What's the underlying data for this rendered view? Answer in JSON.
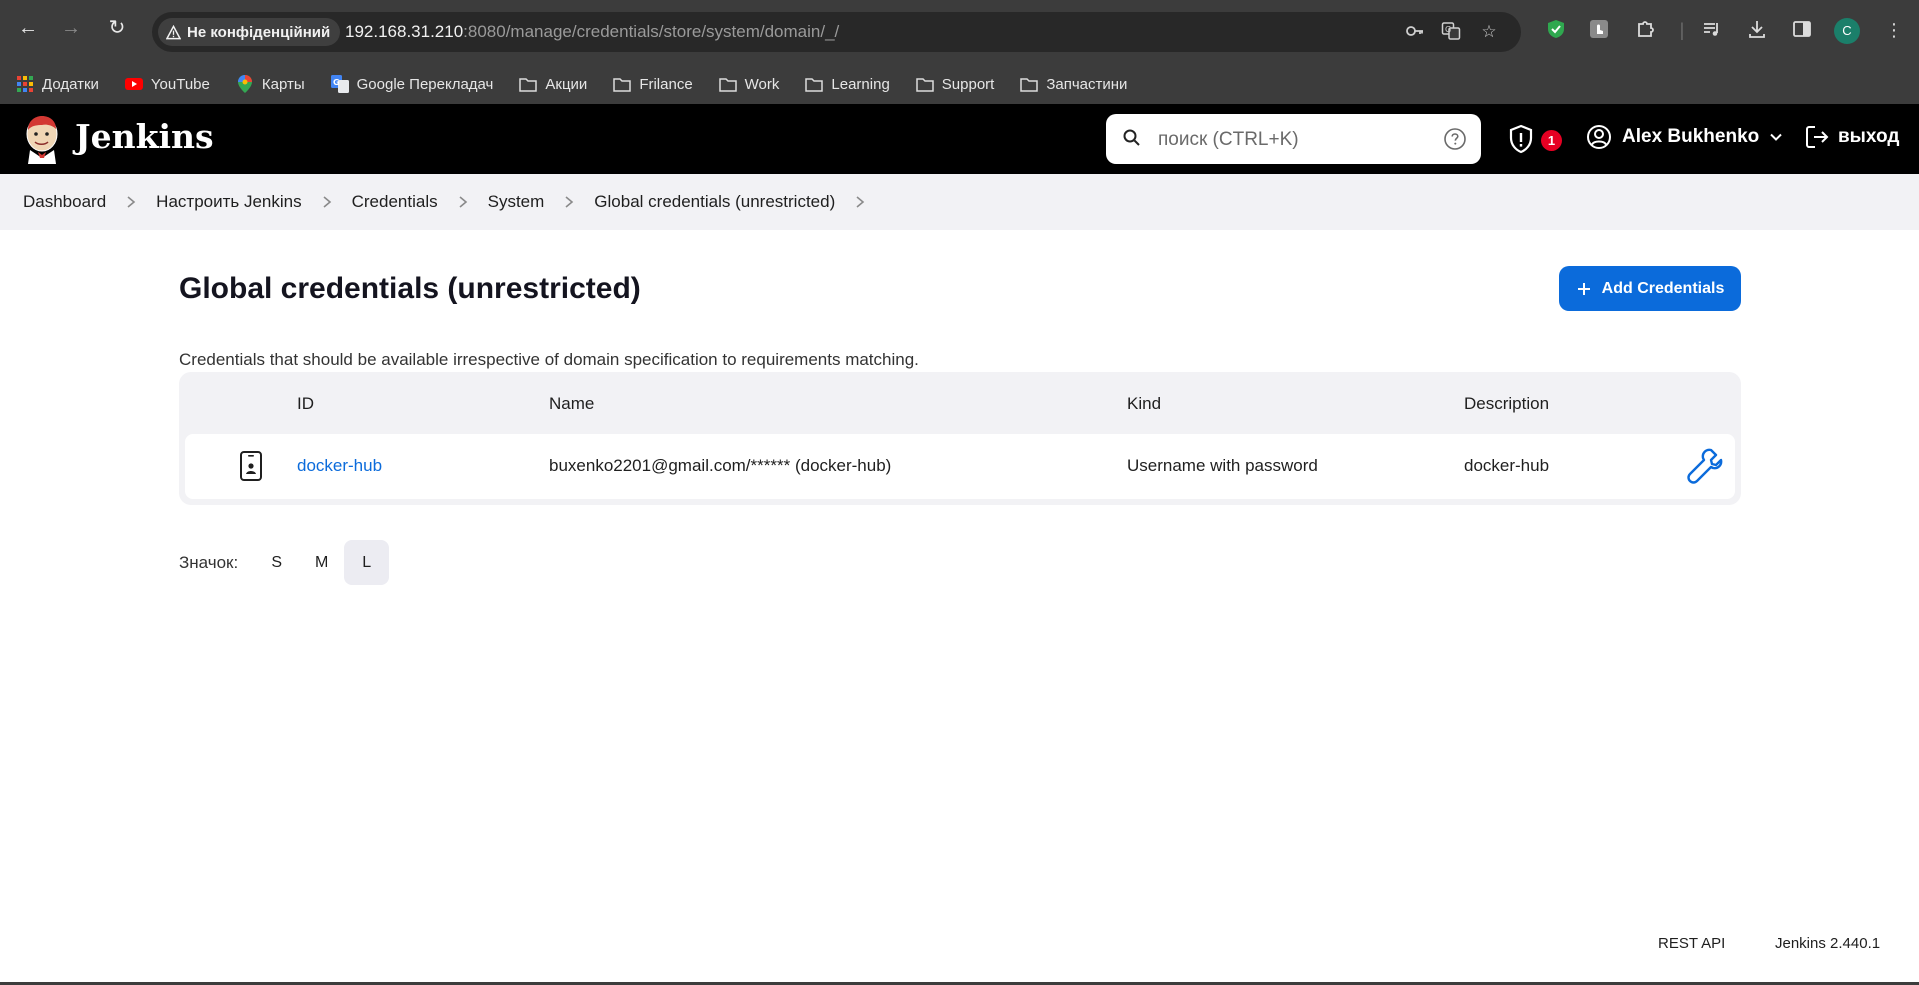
{
  "browser": {
    "security_chip": "Не конфіденційний",
    "url_host": "192.168.31.210",
    "url_rest": ":8080/manage/credentials/store/system/domain/_/",
    "profile_initial": "C",
    "bookmarks": [
      {
        "label": "Додатки",
        "icon": "apps-grid-icon"
      },
      {
        "label": "YouTube",
        "icon": "youtube-icon"
      },
      {
        "label": "Карты",
        "icon": "maps-pin-icon"
      },
      {
        "label": "Google Перекладач",
        "icon": "translate-icon"
      },
      {
        "label": "Акции",
        "icon": "folder-icon"
      },
      {
        "label": "Frilance",
        "icon": "folder-icon"
      },
      {
        "label": "Work",
        "icon": "folder-icon"
      },
      {
        "label": "Learning",
        "icon": "folder-icon"
      },
      {
        "label": "Support",
        "icon": "folder-icon"
      },
      {
        "label": "Запчастини",
        "icon": "folder-icon"
      }
    ]
  },
  "header": {
    "title": "Jenkins",
    "search_placeholder": "поиск (CTRL+K)",
    "security_count": "1",
    "user_name": "Alex Bukhenko",
    "logout_label": "выход"
  },
  "breadcrumb": [
    "Dashboard",
    "Настроить Jenkins",
    "Credentials",
    "System",
    "Global credentials (unrestricted)"
  ],
  "main": {
    "title": "Global credentials (unrestricted)",
    "add_button": "Add Credentials",
    "description": "Credentials that should be available irrespective of domain specification to requirements matching.",
    "table": {
      "headers": {
        "id": "ID",
        "name": "Name",
        "kind": "Kind",
        "description": "Description"
      },
      "rows": [
        {
          "id": "docker-hub",
          "name": "buxenko2201@gmail.com/****** (docker-hub)",
          "kind": "Username with password",
          "description": "docker-hub"
        }
      ]
    },
    "icon_size": {
      "label": "Значок:",
      "options": [
        "S",
        "M",
        "L"
      ],
      "selected": "L"
    }
  },
  "footer": {
    "rest_api": "REST API",
    "version": "Jenkins 2.440.1"
  },
  "colors": {
    "accent": "#0b6bdb",
    "header_bg": "#000000",
    "breadcrumb_bg": "#f2f2f5",
    "badge": "#e60023"
  }
}
